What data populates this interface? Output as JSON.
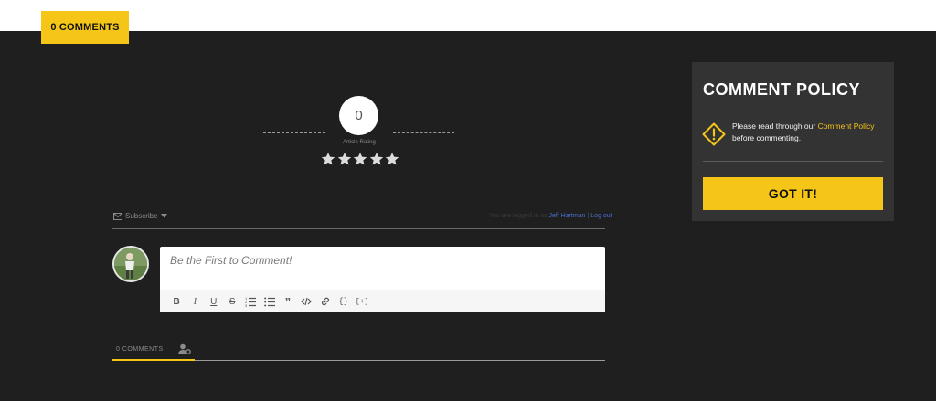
{
  "header": {
    "comments_tab": "0 COMMENTS"
  },
  "rating": {
    "value": "0",
    "caption": "Article Rating",
    "stars_total": 5,
    "stars_filled": 0
  },
  "subscribe": {
    "label": "Subscribe",
    "logged_prefix": "You are logged in as",
    "user": "Jeff Hartman",
    "separator": "|",
    "logout": "Log out"
  },
  "comment_form": {
    "placeholder": "Be the First to Comment!",
    "toolbar": [
      {
        "name": "bold-icon",
        "glyph": "B"
      },
      {
        "name": "italic-icon",
        "glyph": "I"
      },
      {
        "name": "underline-icon",
        "glyph": "U"
      },
      {
        "name": "strikethrough-icon",
        "glyph": "S"
      },
      {
        "name": "ordered-list-icon",
        "glyph": "ol"
      },
      {
        "name": "unordered-list-icon",
        "glyph": "ul"
      },
      {
        "name": "blockquote-icon",
        "glyph": "”"
      },
      {
        "name": "code-icon",
        "glyph": "</>"
      },
      {
        "name": "link-icon",
        "glyph": "link"
      },
      {
        "name": "source-code-icon",
        "glyph": "{}"
      },
      {
        "name": "spoiler-icon",
        "glyph": "[+]"
      }
    ]
  },
  "tabs": {
    "comments_label": "0 COMMENTS"
  },
  "policy": {
    "title": "COMMENT POLICY",
    "text_before": "Please read through our ",
    "link": "Comment Policy",
    "text_after": " before commenting.",
    "button": "GOT IT!"
  },
  "colors": {
    "accent": "#f5c518",
    "background": "#1f1f1f",
    "panel": "#333333",
    "link": "#4a6fd0"
  }
}
